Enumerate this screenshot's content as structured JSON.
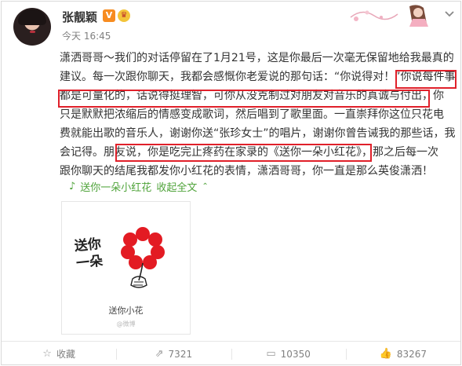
{
  "post": {
    "user_name": "张靓颖",
    "vip_badge": "V",
    "crown_badge": "♛",
    "time": "今天 16:45",
    "lines": [
      "潇洒哥哥～我们的对话停留在了1月21号，这是你最后一次毫无保留地给我最真的",
      "建议。每一次跟你聊天，我都会感慨你老爱说的那句话：“你说得对！”你说每件事",
      "都是可量化的，话说得挺理智，可你从没克制过对朋友对音乐的真诚与付出，你",
      "只是默默把浓缩后的情感变成歌词，然后唱到了歌里面。一直崇拜你这位只花电",
      "费就能出歌的音乐人，谢谢你送“张珍女士”的唱片，谢谢你曾告诫我的那些话，我",
      "会记得。朋友说，你是吃完止疼药在家录的《送你一朵小红花》，那之后每一次",
      "跟你聊天的结尾我都发你小红花的表情，潇洒哥哥，你一直是那么英俊潇洒！"
    ],
    "music_link": "送你一朵小红花",
    "collapse_link": "收起全文",
    "media": {
      "handwriting": "送你一朵",
      "caption": "送你小花",
      "tiny": "@微博"
    }
  },
  "toolbar": {
    "favorite_label": "收藏",
    "repost_count": "7321",
    "comment_count": "10350",
    "like_count": "83267"
  },
  "colors": {
    "highlight": "#e0202a",
    "link": "#4fa33a",
    "flower": "#e31b23"
  }
}
